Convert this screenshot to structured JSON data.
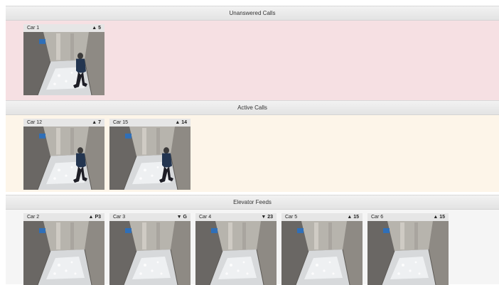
{
  "sections": [
    {
      "id": "unanswered",
      "title": "Unanswered Calls",
      "tiles": [
        {
          "label": "Car 1",
          "direction": "▲",
          "floor": "5",
          "occupied": true
        }
      ]
    },
    {
      "id": "active",
      "title": "Active Calls",
      "tiles": [
        {
          "label": "Car 12",
          "direction": "▲",
          "floor": "7",
          "occupied": true
        },
        {
          "label": "Car 15",
          "direction": "▲",
          "floor": "14",
          "occupied": true
        }
      ]
    },
    {
      "id": "feeds",
      "title": "Elevator Feeds",
      "tiles": [
        {
          "label": "Car 2",
          "direction": "▲",
          "floor": "P3",
          "occupied": false
        },
        {
          "label": "Car 3",
          "direction": "▼",
          "floor": "G",
          "occupied": false
        },
        {
          "label": "Car 4",
          "direction": "▼",
          "floor": "23",
          "occupied": false
        },
        {
          "label": "Car 5",
          "direction": "▲",
          "floor": "15",
          "occupied": false
        },
        {
          "label": "Car 6",
          "direction": "▲",
          "floor": "15",
          "occupied": false
        }
      ]
    }
  ],
  "colors": {
    "unanswered_bg": "#f6e0e3",
    "active_bg": "#fdf5e9",
    "feeds_bg": "#f5f5f5",
    "header_bg": "#e9e9e9"
  }
}
